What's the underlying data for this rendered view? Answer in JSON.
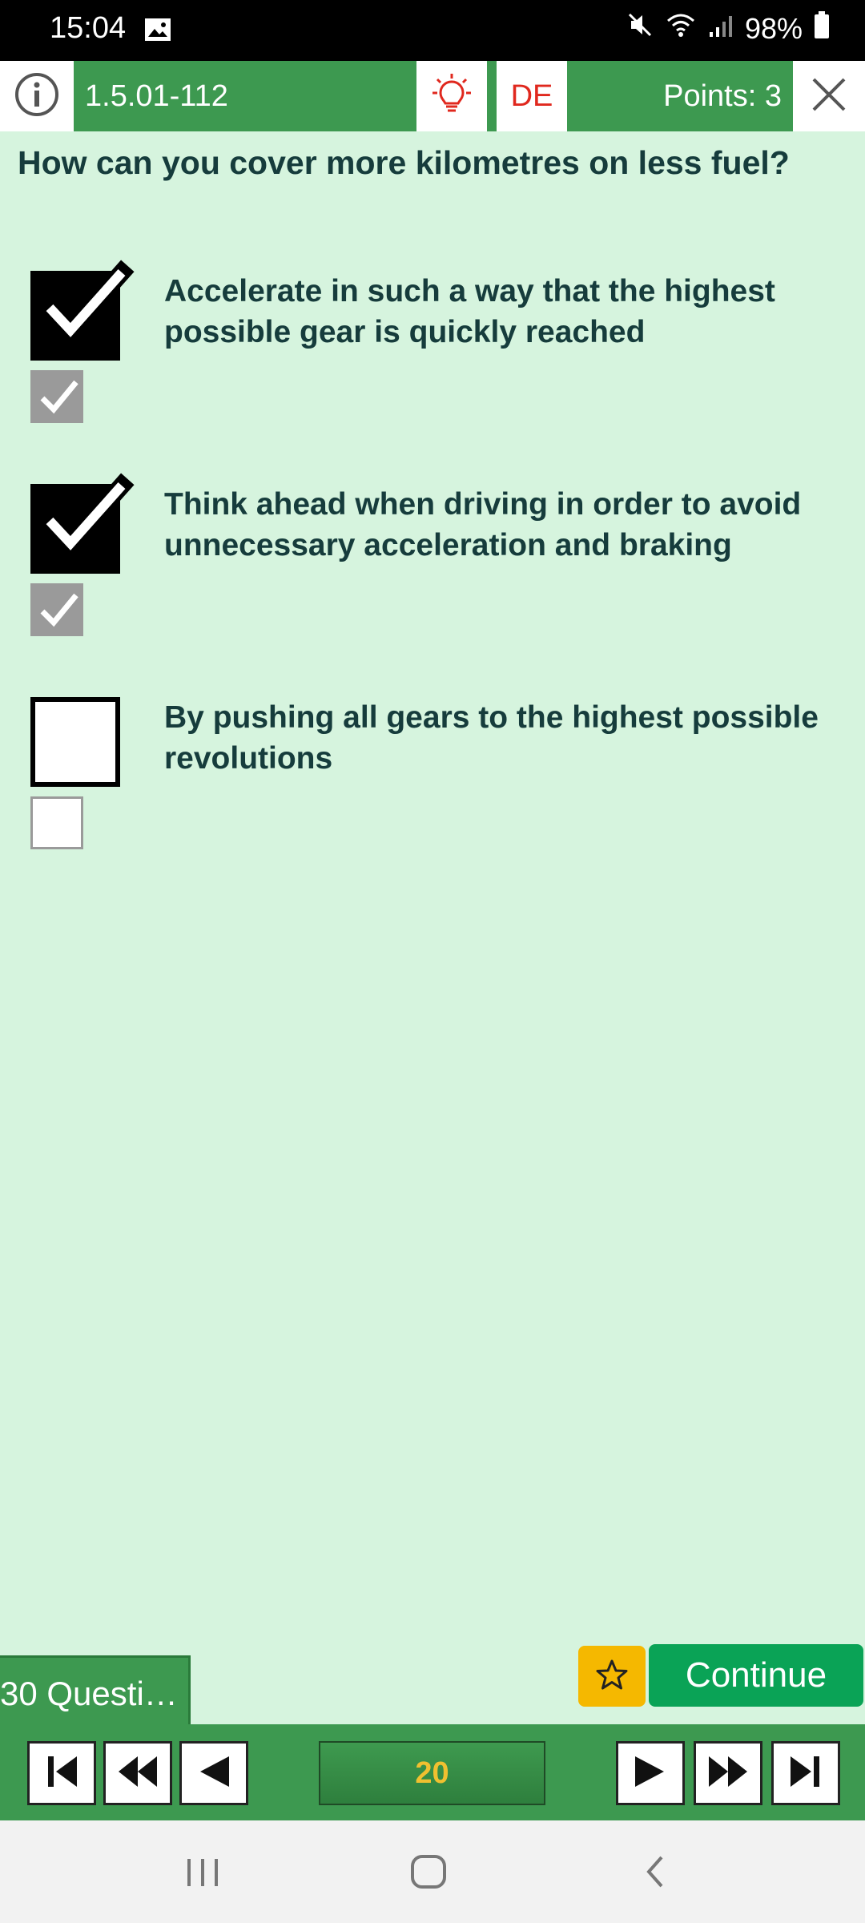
{
  "status_bar": {
    "time": "15:04",
    "battery": "98%"
  },
  "header": {
    "question_id": "1.5.01-112",
    "language": "DE",
    "points": "Points: 3"
  },
  "question": "How can you cover more kilometres on less fuel?",
  "answers": [
    {
      "text": "Accelerate in such a way that the highest possible gear is quickly reached",
      "selected": true,
      "correct": true
    },
    {
      "text": "Think ahead when driving in order to avoid unnecessary acceleration and braking",
      "selected": true,
      "correct": true
    },
    {
      "text": "By pushing all gears to the highest possible revolutions",
      "selected": false,
      "correct": false
    }
  ],
  "bottom": {
    "question_set_tab": "30 Questi…",
    "continue_label": "Continue",
    "page_number": "20"
  },
  "icons": {
    "info": "info-icon",
    "hint": "lightbulb-icon",
    "close": "close-icon",
    "star": "star-icon"
  },
  "colors": {
    "header_green": "#3d9950",
    "background": "#d6f4de",
    "continue_green": "#0aa356",
    "star_yellow": "#f5b800",
    "lang_red": "#e0281e",
    "page_number": "#f0c030"
  }
}
